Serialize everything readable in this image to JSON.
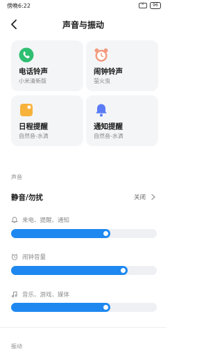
{
  "status_bar": {
    "time": "傍晚6:22",
    "battery": "96"
  },
  "header": {
    "title": "声音与振动"
  },
  "cards": [
    {
      "title": "电话铃声",
      "subtitle": "小米清新版",
      "icon": "phone-icon",
      "color": "#2fbf71"
    },
    {
      "title": "闹钟铃声",
      "subtitle": "萤火虫",
      "icon": "alarm-icon",
      "color": "#f39a7e"
    },
    {
      "title": "日程提醒",
      "subtitle": "自然音-水滴",
      "icon": "calendar-icon",
      "color": "#f7b23b"
    },
    {
      "title": "通知提醒",
      "subtitle": "自然音-水滴",
      "icon": "bell-icon",
      "color": "#5b7cf5"
    }
  ],
  "sound_section": {
    "label": "声音"
  },
  "dnd": {
    "title": "静音/勿扰",
    "value": "关闭"
  },
  "volumes": [
    {
      "label": "来电、提醒、通知",
      "icon": "bell-outline-icon",
      "level": 0.68
    },
    {
      "label": "闹钟音量",
      "icon": "alarm-outline-icon",
      "level": 0.8
    },
    {
      "label": "音乐、游戏、媒体",
      "icon": "music-note-icon",
      "level": 0.68
    }
  ],
  "vibration_section": {
    "label": "振动"
  },
  "colors": {
    "accent": "#1e88f0",
    "track": "#eef0f3",
    "card_bg": "#f4f5f7"
  }
}
